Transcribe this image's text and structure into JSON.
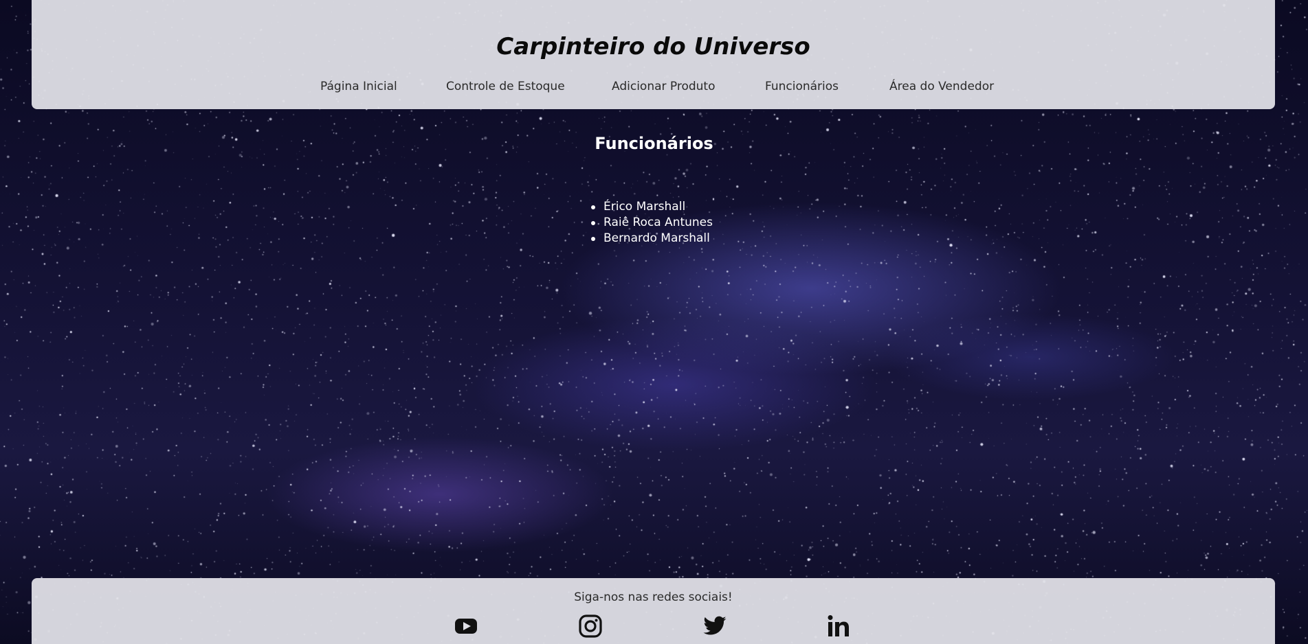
{
  "header": {
    "title": "Carpinteiro do Universo",
    "nav": [
      {
        "label": "Página Inicial"
      },
      {
        "label": "Controle de Estoque"
      },
      {
        "label": "Adicionar Produto"
      },
      {
        "label": "Funcionários"
      },
      {
        "label": "Área do Vendedor"
      }
    ]
  },
  "main": {
    "heading": "Funcionários",
    "employees": [
      "Érico Marshall",
      "Raiê Roca Antunes",
      "Bernardo Marshall"
    ]
  },
  "footer": {
    "text": "Siga-nos nas redes sociais!",
    "social_icons": [
      "youtube-icon",
      "instagram-icon",
      "twitter-icon",
      "linkedin-icon"
    ]
  },
  "colors": {
    "header_bg": "#e1e1e8",
    "text_dark": "#0a0a0a",
    "text_light": "#ffffff"
  }
}
